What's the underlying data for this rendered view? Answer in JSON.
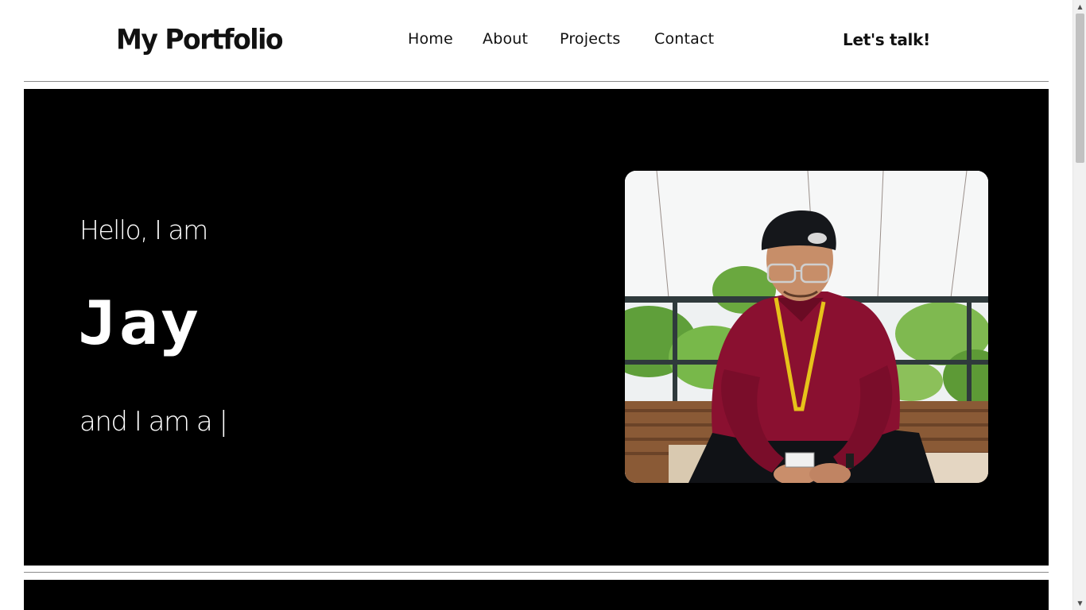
{
  "header": {
    "logo": "My Portfolio",
    "nav": {
      "home": "Home",
      "about": "About",
      "projects": "Projects",
      "contact": "Contact"
    },
    "cta": "Let's talk!"
  },
  "hero": {
    "greeting": "Hello, I am",
    "name": "Jay",
    "role": "and I am a |",
    "photo_icon": "profile-photo"
  },
  "colors": {
    "hero_bg": "#000000",
    "page_bg": "#ffffff",
    "text_dark": "#111111",
    "shirt": "#8a1030",
    "lanyard": "#e6c21a"
  }
}
